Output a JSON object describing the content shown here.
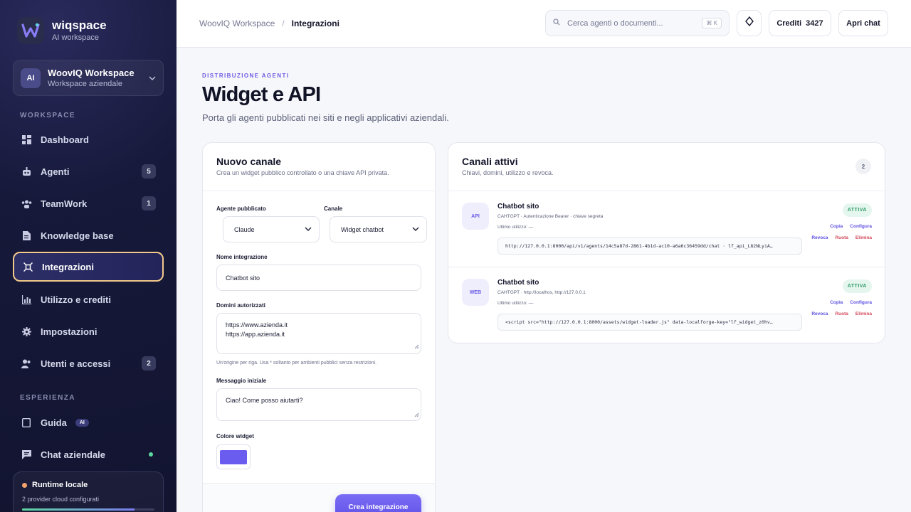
{
  "brand": {
    "name": "wiqspace",
    "subtitle": "AI workspace"
  },
  "workspace": {
    "avatar": "AI",
    "name": "WoovIQ Workspace",
    "subtitle": "Workspace aziendale"
  },
  "sidebar": {
    "section1": "WORKSPACE",
    "items": [
      {
        "label": "Dashboard",
        "icon": "dashboard-icon"
      },
      {
        "label": "Agenti",
        "icon": "robot-icon",
        "badge": "5"
      },
      {
        "label": "TeamWork",
        "icon": "team-icon",
        "badge": "1"
      },
      {
        "label": "Knowledge base",
        "icon": "document-icon"
      },
      {
        "label": "Integrazioni",
        "icon": "integration-icon",
        "active": true
      },
      {
        "label": "Utilizzo e crediti",
        "icon": "chart-icon"
      },
      {
        "label": "Impostazioni",
        "icon": "gear-icon"
      },
      {
        "label": "Utenti e accessi",
        "icon": "users-icon",
        "badge": "2"
      }
    ],
    "section2": "ESPERIENZA",
    "items2": [
      {
        "label": "Guida",
        "icon": "book-icon",
        "pill": "AI"
      },
      {
        "label": "Chat aziendale",
        "icon": "chat-icon"
      }
    ],
    "runtime": {
      "title": "Runtime locale",
      "subtitle": "2 provider cloud configurati"
    }
  },
  "topbar": {
    "breadcrumb_root": "WoovIQ Workspace",
    "breadcrumb_sep": "/",
    "breadcrumb_current": "Integrazioni",
    "search_placeholder": "Cerca agenti o documenti...",
    "search_kbd": "⌘ K",
    "credits_label": "Crediti",
    "credits_value": "3427",
    "open_chat": "Apri chat"
  },
  "page": {
    "eyebrow": "DISTRIBUZIONE AGENTI",
    "title": "Widget e API",
    "subtitle": "Porta gli agenti pubblicati nei siti e negli applicativi aziendali."
  },
  "new_channel": {
    "title": "Nuovo canale",
    "subtitle": "Crea un widget pubblico controllato o una chiave API privata.",
    "agent_label": "Agente pubblicato",
    "agent_value": "Claude",
    "channel_label": "Canale",
    "channel_value": "Widget chatbot",
    "name_label": "Nome integrazione",
    "name_value": "Chatbot sito",
    "domains_label": "Domini autorizzati",
    "domains_line1": "https://www.azienda.it",
    "domains_line2": "https://app.azienda.it",
    "domains_hint": "Un'origine per riga. Usa * soltanto per ambienti pubblici senza restrizioni.",
    "message_label": "Messaggio iniziale",
    "message_value": "Ciao! Come posso aiutarti?",
    "color_label": "Colore widget",
    "color_value": "#6b5cf0",
    "submit": "Crea integrazione"
  },
  "active_channels": {
    "title": "Canali attivi",
    "subtitle": "Chiavi, domini, utilizzo e revoca.",
    "count": "2",
    "items": [
      {
        "tag": "API",
        "name": "Chatbot sito",
        "meta": "CAHTGPT · Autenticazione Bearer · chiave segreta",
        "used": "Ultimo utilizzo: —",
        "code": "http://127.0.0.1:8000/api/v1/agents/14c5a87d-2861-4b1d-ac10-a6a6c36459dd/chat · lf_api_L82NLyiA…",
        "status": "ATTIVA",
        "copy": "Copia",
        "configure": "Configura",
        "revoke": "Revoca",
        "rotate": "Ruota",
        "delete": "Elimina"
      },
      {
        "tag": "WEB",
        "name": "Chatbot sito",
        "meta": "CAHTGPT · http://localhos, http://127.0.0.1",
        "used": "Ultimo utilizzo: —",
        "code": "<script src=\"http://127.0.0.1:8000/assets/widget-loader.js\" data-localforge-key=\"lf_widget_z0hv…",
        "status": "ATTIVA",
        "copy": "Copia",
        "configure": "Configura",
        "revoke": "Revoca",
        "rotate": "Ruota",
        "delete": "Elimina"
      }
    ]
  }
}
